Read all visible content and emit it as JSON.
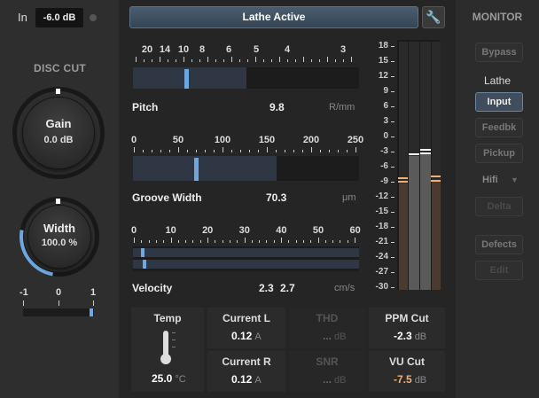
{
  "input": {
    "label": "In",
    "value": "-6.0 dB"
  },
  "disc_cut": {
    "title": "DISC CUT",
    "gain": {
      "name": "Gain",
      "value": "0.0 dB",
      "level": 0.5
    },
    "width": {
      "name": "Width",
      "value": "100.0 %",
      "level": 0.5
    },
    "balance": {
      "labels": [
        "-1",
        "0",
        "1"
      ],
      "level": 1.0
    }
  },
  "header": {
    "button_label": "Lathe Active",
    "wrench_icon": "wrench-icon"
  },
  "pitch": {
    "name": "Pitch",
    "value": "9.8",
    "unit": "R/mm",
    "scale": [
      "20",
      "14",
      "10",
      "8",
      "6",
      "5",
      "4",
      "3"
    ]
  },
  "groove": {
    "name": "Groove Width",
    "value": "70.3",
    "unit": "μm",
    "scale": [
      "0",
      "50",
      "100",
      "150",
      "200",
      "250"
    ]
  },
  "velocity": {
    "name": "Velocity",
    "value_l": "2.3",
    "value_r": "2.7",
    "unit": "cm/s",
    "scale": [
      "0",
      "10",
      "20",
      "30",
      "40",
      "50",
      "60"
    ]
  },
  "vu": {
    "scale": [
      "18",
      "15",
      "12",
      "9",
      "6",
      "3",
      "0",
      "-3",
      "-6",
      "-9",
      "-12",
      "-15",
      "-18",
      "-21",
      "-24",
      "-27",
      "-30"
    ]
  },
  "panels": {
    "temp": {
      "label": "Temp",
      "value": "25.0",
      "unit": "°C"
    },
    "current_l": {
      "label": "Current L",
      "value": "0.12",
      "unit": "A"
    },
    "current_r": {
      "label": "Current R",
      "value": "0.12",
      "unit": "A"
    },
    "thd": {
      "label": "THD",
      "value": "...",
      "unit": "dB"
    },
    "snr": {
      "label": "SNR",
      "value": "...",
      "unit": "dB"
    },
    "ppm": {
      "label": "PPM Cut",
      "value": "-2.3",
      "unit": "dB"
    },
    "vucut": {
      "label": "VU Cut",
      "value": "-7.5",
      "unit": "dB"
    }
  },
  "monitor": {
    "title": "MONITOR",
    "bypass": "Bypass",
    "lathe_label": "Lathe",
    "input": "Input",
    "feedbk": "Feedbk",
    "pickup": "Pickup",
    "hifi": "Hifi",
    "delta": "Delta",
    "defects": "Defects",
    "edit": "Edit"
  },
  "colors": {
    "accent": "#6ea8e0",
    "orange": "#f0b070",
    "button": "#3f4d5c"
  }
}
